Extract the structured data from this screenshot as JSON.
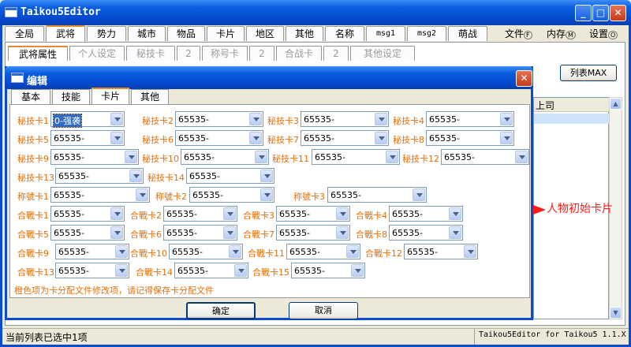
{
  "app": {
    "title": "Taikou5Editor"
  },
  "main_tabs": [
    "全局",
    "武将",
    "势力",
    "城市",
    "物品",
    "卡片",
    "地区",
    "其他",
    "名称",
    "msg1",
    "msg2",
    "萌战"
  ],
  "menu": [
    {
      "label": "文件",
      "key": "F"
    },
    {
      "label": "内存",
      "key": "M"
    },
    {
      "label": "设置",
      "key": "O"
    }
  ],
  "sub_tabs": [
    "武将属性",
    "个人设定",
    "秘技卡",
    "2",
    "称号卡",
    "2",
    "合战卡",
    "2",
    "其他设定"
  ],
  "toolbar": {
    "list_button": "列表MAX"
  },
  "list": {
    "header": "上司"
  },
  "dialog": {
    "title": "编辑",
    "tabs": [
      "基本",
      "技能",
      "卡片",
      "其他"
    ],
    "rows": [
      [
        {
          "label": "秘技卡1",
          "value": "0-强袭",
          "highlight": true
        },
        {
          "label": "秘技卡2",
          "value": "65535-"
        },
        {
          "label": "秘技卡3",
          "value": "65535-"
        },
        {
          "label": "秘技卡4",
          "value": "65535-"
        }
      ],
      [
        {
          "label": "秘技卡5",
          "value": "65535-"
        },
        {
          "label": "秘技卡6",
          "value": "65535-"
        },
        {
          "label": "秘技卡7",
          "value": "65535-"
        },
        {
          "label": "秘技卡8",
          "value": "65535-"
        }
      ],
      [
        {
          "label": "秘技卡9",
          "value": "65535-"
        },
        {
          "label": "秘技卡10",
          "value": "65535-"
        },
        {
          "label": "秘技卡11",
          "value": "65535-"
        },
        {
          "label": "秘技卡12",
          "value": "65535-"
        }
      ],
      [
        {
          "label": "秘技卡13",
          "value": "65535-"
        },
        {
          "label": "秘技卡14",
          "value": "65535-"
        }
      ],
      [
        {
          "label": "称號卡1",
          "value": "65535-"
        },
        {
          "label": "称號卡2",
          "value": "65535-"
        },
        {
          "label": "称號卡3",
          "value": "65535-"
        }
      ],
      [
        {
          "label": "合戰卡1",
          "value": "65535-"
        },
        {
          "label": "合戰卡2",
          "value": "65535-"
        },
        {
          "label": "合戰卡3",
          "value": "65535-"
        },
        {
          "label": "合戰卡4",
          "value": "65535-"
        }
      ],
      [
        {
          "label": "合戰卡5",
          "value": "65535-"
        },
        {
          "label": "合戰卡6",
          "value": "65535-"
        },
        {
          "label": "合戰卡7",
          "value": "65535-"
        },
        {
          "label": "合戰卡8",
          "value": "65535-"
        }
      ],
      [
        {
          "label": "合戰卡9",
          "value": "65535-"
        },
        {
          "label": "合戰卡10",
          "value": "65535-"
        },
        {
          "label": "合戰卡11",
          "value": "65535-"
        },
        {
          "label": "合戰卡12",
          "value": "65535-"
        }
      ],
      [
        {
          "label": "合戰卡13",
          "value": "65535-"
        },
        {
          "label": "合戰卡14",
          "value": "65535-"
        },
        {
          "label": "合戰卡15",
          "value": "65535-"
        }
      ]
    ],
    "note": "橙色项为卡分配文件修改项，请记得保存卡分配文件",
    "ok_button": "确定",
    "cancel_button": "取消"
  },
  "annotation": {
    "text": "人物初始卡片",
    "color": "#ff1a1a"
  },
  "status": {
    "left": "当前列表已选中1项",
    "right": "Taikou5Editor for Taikou5 1.1.X"
  },
  "colors": {
    "titlebar": "#0a5de0",
    "label": "#e46f0a",
    "selected_tab_accent": "#e68b2c"
  }
}
